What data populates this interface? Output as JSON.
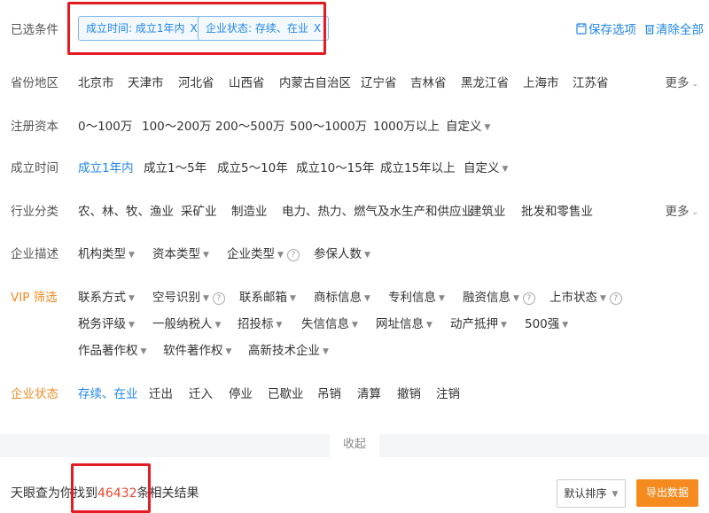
{
  "selected": {
    "label": "已选条件",
    "chips": [
      "成立时间: 成立1年内",
      "企业状态: 存续、在业"
    ],
    "chip_close": "X",
    "save_label": "保存选项",
    "clear_label": "清除全部"
  },
  "rows": {
    "province": {
      "label": "省份地区",
      "options": [
        "北京市",
        "天津市",
        "河北省",
        "山西省",
        "内蒙古自治区",
        "辽宁省",
        "吉林省",
        "黑龙江省",
        "上海市",
        "江苏省"
      ],
      "more": "更多"
    },
    "capital": {
      "label": "注册资本",
      "options": [
        "0～100万",
        "100～200万",
        "200～500万",
        "500～1000万",
        "1000万以上",
        "自定义"
      ]
    },
    "founded": {
      "label": "成立时间",
      "options": [
        "成立1年内",
        "成立1～5年",
        "成立5～10年",
        "成立10～15年",
        "成立15年以上",
        "自定义"
      ]
    },
    "industry": {
      "label": "行业分类",
      "options": [
        "农、林、牧、渔业",
        "采矿业",
        "制造业",
        "电力、热力、燃气及水生产和供应业",
        "建筑业",
        "批发和零售业"
      ],
      "more": "更多"
    },
    "desc": {
      "label": "企业描述",
      "options": [
        "机构类型",
        "资本类型",
        "企业类型",
        "参保人数"
      ]
    },
    "vip": {
      "label": "VIP 筛选",
      "line1": [
        "联系方式",
        "空号识别",
        "联系邮箱",
        "商标信息",
        "专利信息",
        "融资信息",
        "上市状态"
      ],
      "line2": [
        "税务评级",
        "一般纳税人",
        "招投标",
        "失信信息",
        "网址信息",
        "动产抵押",
        "500强"
      ],
      "line3": [
        "作品著作权",
        "软件著作权",
        "高新技术企业"
      ]
    },
    "status": {
      "label": "企业状态",
      "options": [
        "存续、在业",
        "迁出",
        "迁入",
        "停业",
        "已歇业",
        "吊销",
        "清算",
        "撤销",
        "注销"
      ]
    }
  },
  "collapse_label": "收起",
  "footer": {
    "prefix": "天眼查为你找到",
    "count": "46432",
    "suffix": "条相关结果",
    "sort_label": "默认排序",
    "export_label": "导出数据"
  },
  "colors": {
    "accent": "#1f86e8",
    "vip": "#f08a24",
    "export": "#f58a1f",
    "highlight_box": "#e31b23"
  },
  "icons": {
    "save": "save-icon",
    "trash": "trash-icon",
    "chevron": "chevron-down-icon",
    "caret": "caret-down-icon",
    "help": "help-circle-icon"
  }
}
